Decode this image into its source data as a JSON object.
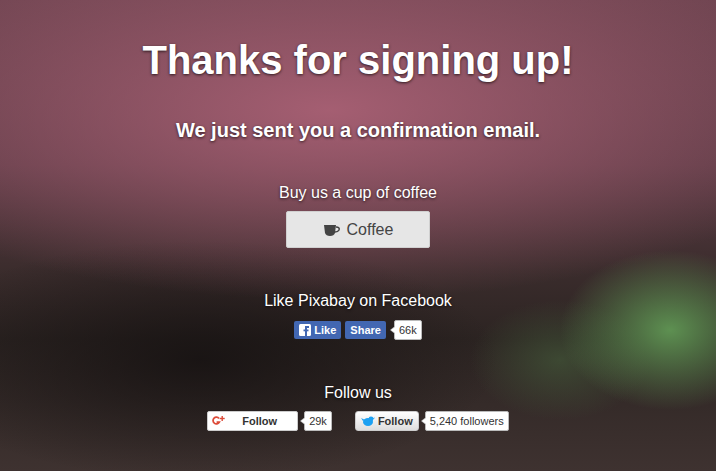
{
  "heading": "Thanks for signing up!",
  "subheading": "We just sent you a confirmation email.",
  "coffee": {
    "label": "Buy us a cup of coffee",
    "button": "Coffee"
  },
  "facebook": {
    "label": "Like Pixabay on Facebook",
    "like": "Like",
    "share": "Share",
    "count": "66k"
  },
  "follow": {
    "label": "Follow us",
    "google_plus": {
      "button": "Follow",
      "count": "29k"
    },
    "twitter": {
      "button": "Follow",
      "count": "5,240 followers"
    }
  }
}
